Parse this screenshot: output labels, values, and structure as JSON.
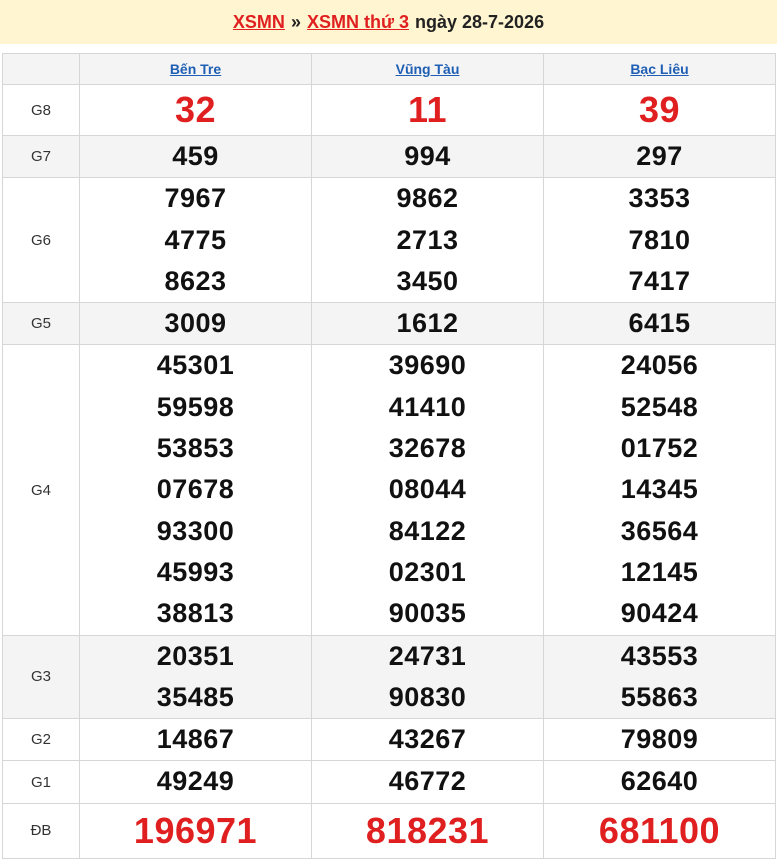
{
  "header": {
    "link1": "XSMN",
    "separator": "»",
    "link2": "XSMN thứ 3",
    "date_text": "ngày 28-7-2026"
  },
  "provinces": [
    "Bến Tre",
    "Vũng Tàu",
    "Bạc Liêu"
  ],
  "rows": [
    {
      "label": "G8",
      "values": [
        [
          "32"
        ],
        [
          "11"
        ],
        [
          "39"
        ]
      ]
    },
    {
      "label": "G7",
      "values": [
        [
          "459"
        ],
        [
          "994"
        ],
        [
          "297"
        ]
      ]
    },
    {
      "label": "G6",
      "values": [
        [
          "7967",
          "4775",
          "8623"
        ],
        [
          "9862",
          "2713",
          "3450"
        ],
        [
          "3353",
          "7810",
          "7417"
        ]
      ]
    },
    {
      "label": "G5",
      "values": [
        [
          "3009"
        ],
        [
          "1612"
        ],
        [
          "6415"
        ]
      ]
    },
    {
      "label": "G4",
      "values": [
        [
          "45301",
          "59598",
          "53853",
          "07678",
          "93300",
          "45993",
          "38813"
        ],
        [
          "39690",
          "41410",
          "32678",
          "08044",
          "84122",
          "02301",
          "90035"
        ],
        [
          "24056",
          "52548",
          "01752",
          "14345",
          "36564",
          "12145",
          "90424"
        ]
      ]
    },
    {
      "label": "G3",
      "values": [
        [
          "20351",
          "35485"
        ],
        [
          "24731",
          "90830"
        ],
        [
          "43553",
          "55863"
        ]
      ]
    },
    {
      "label": "G2",
      "values": [
        [
          "14867"
        ],
        [
          "43267"
        ],
        [
          "79809"
        ]
      ]
    },
    {
      "label": "G1",
      "values": [
        [
          "49249"
        ],
        [
          "46772"
        ],
        [
          "62640"
        ]
      ]
    },
    {
      "label": "ĐB",
      "values": [
        [
          "196971"
        ],
        [
          "818231"
        ],
        [
          "681100"
        ]
      ]
    }
  ],
  "colors": {
    "accent_red": "#e02020",
    "link_blue": "#1e5fb4",
    "header_bg": "#fff6d1"
  }
}
